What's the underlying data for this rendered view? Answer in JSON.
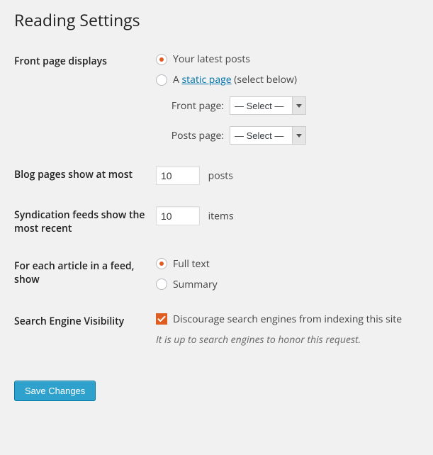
{
  "page": {
    "title": "Reading Settings"
  },
  "front_page": {
    "heading": "Front page displays",
    "options": {
      "latest": "Your latest posts",
      "static_prefix": "A ",
      "static_link": "static page",
      "static_suffix": " (select below)"
    },
    "selected": "latest",
    "front_label": "Front page:",
    "posts_label": "Posts page:",
    "select_placeholder": "— Select —"
  },
  "blog_pages": {
    "heading": "Blog pages show at most",
    "value": "10",
    "unit": "posts"
  },
  "syndication": {
    "heading": "Syndication feeds show the most recent",
    "value": "10",
    "unit": "items"
  },
  "article_feed": {
    "heading": "For each article in a feed, show",
    "full": "Full text",
    "summary": "Summary",
    "selected": "full"
  },
  "visibility": {
    "heading": "Search Engine Visibility",
    "checkbox_label": "Discourage search engines from indexing this site",
    "checked": true,
    "note": "It is up to search engines to honor this request."
  },
  "actions": {
    "save": "Save Changes"
  }
}
